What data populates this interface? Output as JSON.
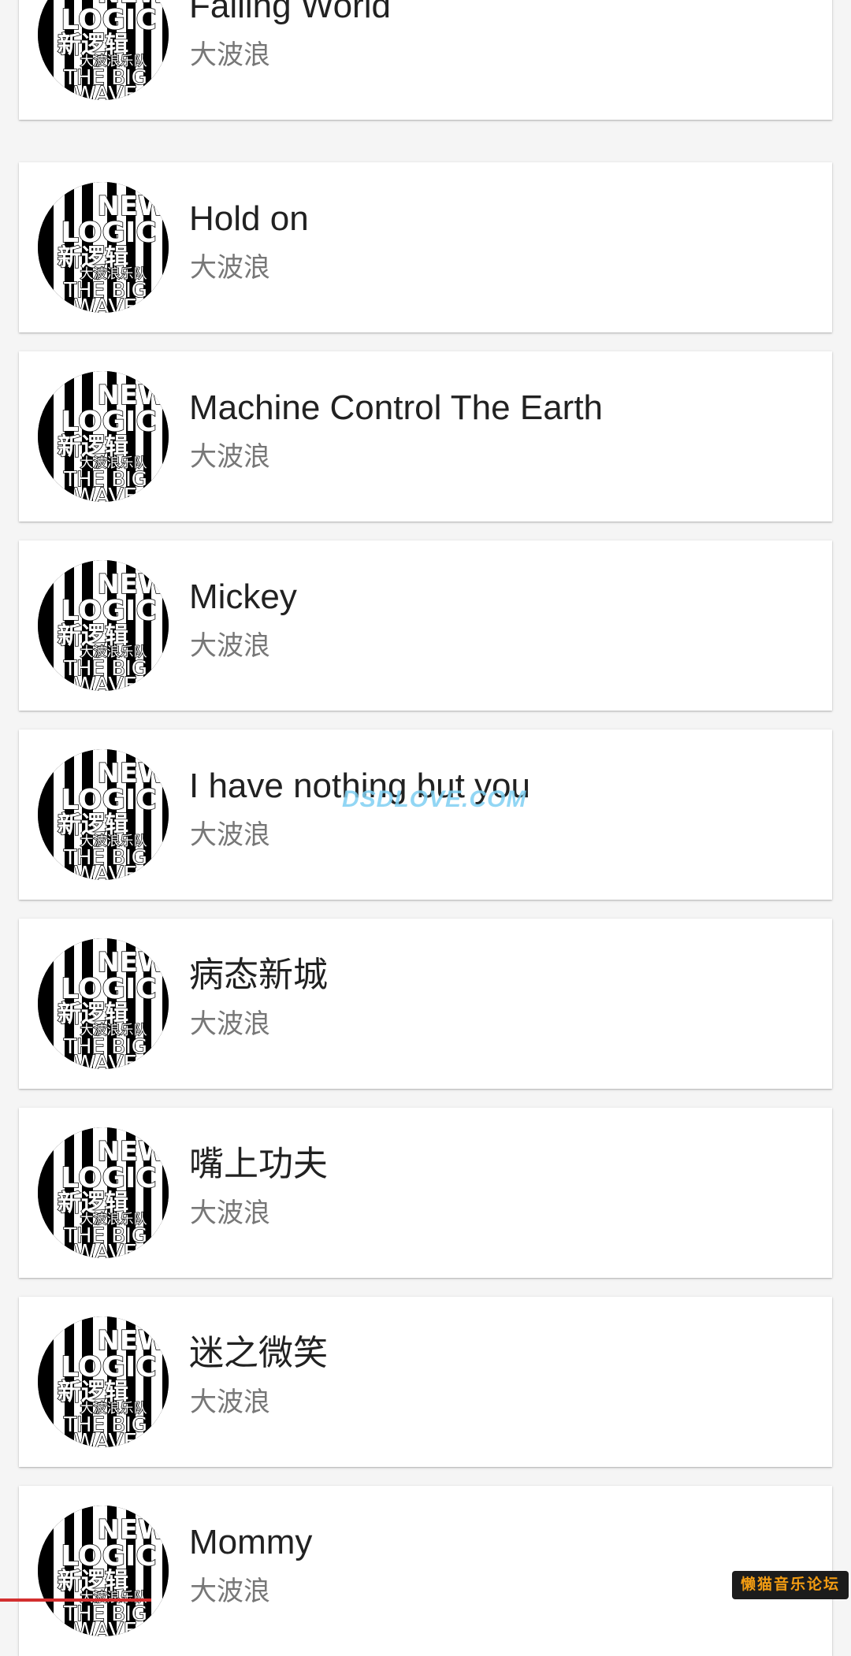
{
  "cover": {
    "line1": "NEW",
    "line2": "LOGIC",
    "line3": "新逻辑",
    "line4": "大波浪乐队",
    "line5": "THE BIG",
    "line6": "WAVE"
  },
  "songs": [
    {
      "title": "Falling World",
      "artist": "大波浪"
    },
    {
      "title": "Hold on",
      "artist": "大波浪"
    },
    {
      "title": "Machine Control The Earth",
      "artist": "大波浪"
    },
    {
      "title": "Mickey",
      "artist": "大波浪"
    },
    {
      "title": "I have nothing but you",
      "artist": "大波浪"
    },
    {
      "title": "病态新城",
      "artist": "大波浪"
    },
    {
      "title": "嘴上功夫",
      "artist": "大波浪"
    },
    {
      "title": "迷之微笑",
      "artist": "大波浪"
    },
    {
      "title": "Mommy",
      "artist": "大波浪"
    }
  ],
  "watermark": "DSDLOVE.COM",
  "forum_badge": "懒猫音乐论坛"
}
